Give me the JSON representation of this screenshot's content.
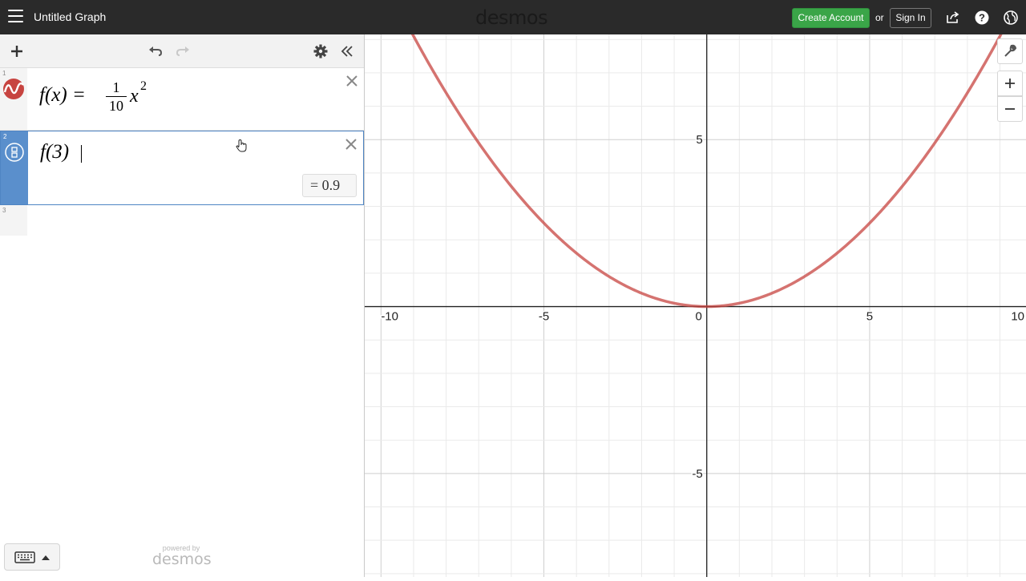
{
  "header": {
    "title": "Untitled Graph",
    "logo": "desmos",
    "create_account": "Create Account",
    "or": "or",
    "sign_in": "Sign In",
    "icons": [
      "menu-icon",
      "share-icon",
      "help-icon",
      "globe-icon"
    ]
  },
  "expressions": {
    "items": [
      {
        "index": "1",
        "lhs": "f(x) =",
        "numerator": "1",
        "denominator": "10",
        "var": "x",
        "exponent": "2",
        "color": "#c74440"
      },
      {
        "index": "2",
        "text": "f(3)",
        "result": "= 0.9"
      },
      {
        "index": "3"
      }
    ]
  },
  "footer": {
    "powered_by": "powered by",
    "brand": "desmos"
  },
  "graph": {
    "curve_color": "#c74440",
    "x_labels": [
      "-10",
      "-5",
      "0",
      "5",
      "10"
    ],
    "y_labels": [
      "5",
      "-5"
    ]
  },
  "chart_data": {
    "type": "line",
    "function": "f(x) = 1/10 x^2",
    "xlim": [
      -10.5,
      9.8
    ],
    "ylim": [
      -8.1,
      8.15
    ],
    "x_ticks": [
      -10,
      -5,
      0,
      5,
      10
    ],
    "y_ticks": [
      -5,
      5
    ],
    "grid": true,
    "series": [
      {
        "x": [
          -10,
          -8,
          -6,
          -4,
          -2,
          0,
          2,
          4,
          6,
          8,
          10
        ],
        "y": [
          10,
          6.4,
          3.6,
          1.6,
          0.4,
          0,
          0.4,
          1.6,
          3.6,
          6.4,
          10
        ]
      }
    ]
  }
}
